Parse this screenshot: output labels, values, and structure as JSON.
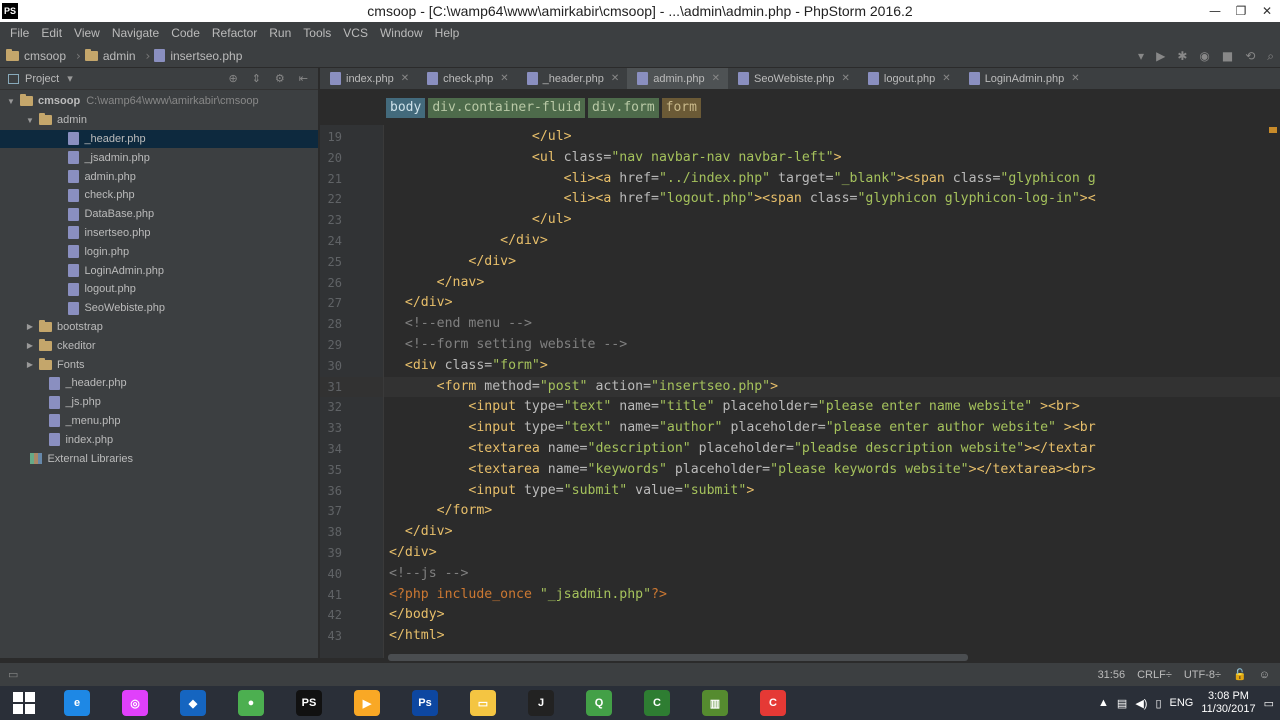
{
  "window": {
    "title": "cmsoop - [C:\\wamp64\\www\\amirkabir\\cmsoop] - ...\\admin\\admin.php - PhpStorm 2016.2",
    "app_icon": "PS"
  },
  "menu": [
    "File",
    "Edit",
    "View",
    "Navigate",
    "Code",
    "Refactor",
    "Run",
    "Tools",
    "VCS",
    "Window",
    "Help"
  ],
  "navbar": {
    "items": [
      "cmsoop",
      "admin",
      "insertseo.php"
    ]
  },
  "project": {
    "label": "Project",
    "root_name": "cmsoop",
    "root_path": "C:\\wamp64\\www\\amirkabir\\cmsoop",
    "admin_folder": "admin",
    "admin_files": [
      "_header.php",
      "_jsadmin.php",
      "admin.php",
      "check.php",
      "DataBase.php",
      "insertseo.php",
      "login.php",
      "LoginAdmin.php",
      "logout.php",
      "SeoWebiste.php"
    ],
    "folders": [
      "bootstrap",
      "ckeditor",
      "Fonts"
    ],
    "root_files": [
      "_header.php",
      "_js.php",
      "_menu.php",
      "index.php"
    ],
    "ext_libs": "External Libraries"
  },
  "tabs": [
    "index.php",
    "check.php",
    "_header.php",
    "admin.php",
    "SeoWebiste.php",
    "logout.php",
    "LoginAdmin.php"
  ],
  "breadcrumbs": [
    "body",
    "div.container-fluid",
    "div.form",
    "form"
  ],
  "code_lines": [
    {
      "n": "19",
      "segs": [
        [
          "t",
          "                  </ul>"
        ]
      ]
    },
    {
      "n": "20",
      "segs": [
        [
          "t",
          "                  <ul "
        ],
        [
          "a",
          "class="
        ],
        [
          "s",
          "\"nav navbar-nav navbar-left\""
        ],
        [
          "t",
          ">"
        ]
      ]
    },
    {
      "n": "21",
      "segs": [
        [
          "t",
          "                      <li><a "
        ],
        [
          "a",
          "href="
        ],
        [
          "s",
          "\"../index.php\""
        ],
        [
          "a",
          " target="
        ],
        [
          "s",
          "\"_blank\""
        ],
        [
          "t",
          "><span "
        ],
        [
          "a",
          "class="
        ],
        [
          "s",
          "\"glyphicon g"
        ]
      ]
    },
    {
      "n": "22",
      "segs": [
        [
          "t",
          "                      <li><a "
        ],
        [
          "a",
          "href="
        ],
        [
          "s",
          "\"logout.php\""
        ],
        [
          "t",
          "><span "
        ],
        [
          "a",
          "class="
        ],
        [
          "s",
          "\"glyphicon glyphicon-log-in\""
        ],
        [
          "t",
          "><"
        ]
      ]
    },
    {
      "n": "23",
      "segs": [
        [
          "t",
          "                  </ul>"
        ]
      ]
    },
    {
      "n": "24",
      "segs": [
        [
          "t",
          "              </div>"
        ]
      ]
    },
    {
      "n": "25",
      "segs": [
        [
          "t",
          "          </div>"
        ]
      ]
    },
    {
      "n": "26",
      "segs": [
        [
          "t",
          "      </nav>"
        ]
      ]
    },
    {
      "n": "27",
      "segs": [
        [
          "t",
          "  </div>"
        ]
      ]
    },
    {
      "n": "28",
      "segs": [
        [
          "c",
          "  <!--end menu -->"
        ]
      ]
    },
    {
      "n": "29",
      "segs": [
        [
          "c",
          "  <!--form setting website -->"
        ]
      ]
    },
    {
      "n": "30",
      "segs": [
        [
          "t",
          "  <div "
        ],
        [
          "a",
          "class="
        ],
        [
          "s",
          "\"form\""
        ],
        [
          "t",
          ">"
        ]
      ]
    },
    {
      "n": "31",
      "segs": [
        [
          "t",
          "      <form "
        ],
        [
          "a",
          "method="
        ],
        [
          "s",
          "\"post\""
        ],
        [
          "a",
          " action="
        ],
        [
          "s",
          "\"insertseo.php\""
        ],
        [
          "t",
          ">"
        ]
      ],
      "current": true
    },
    {
      "n": "32",
      "segs": [
        [
          "t",
          "          <input "
        ],
        [
          "a",
          "type="
        ],
        [
          "s",
          "\"text\""
        ],
        [
          "a",
          " name="
        ],
        [
          "s",
          "\"title\""
        ],
        [
          "a",
          " placeholder="
        ],
        [
          "s",
          "\"please enter name website\""
        ],
        [
          "t",
          " ><br>"
        ]
      ]
    },
    {
      "n": "33",
      "segs": [
        [
          "t",
          "          <input "
        ],
        [
          "a",
          "type="
        ],
        [
          "s",
          "\"text\""
        ],
        [
          "a",
          " name="
        ],
        [
          "s",
          "\"author\""
        ],
        [
          "a",
          " placeholder="
        ],
        [
          "s",
          "\"please enter author website\""
        ],
        [
          "t",
          " ><br"
        ]
      ]
    },
    {
      "n": "34",
      "segs": [
        [
          "t",
          "          <textarea "
        ],
        [
          "a",
          "name="
        ],
        [
          "s",
          "\"description\""
        ],
        [
          "a",
          " placeholder="
        ],
        [
          "s",
          "\"pleadse description website\""
        ],
        [
          "t",
          "></textar"
        ]
      ]
    },
    {
      "n": "35",
      "segs": [
        [
          "t",
          "          <textarea "
        ],
        [
          "a",
          "name="
        ],
        [
          "s",
          "\"keywords\""
        ],
        [
          "a",
          " placeholder="
        ],
        [
          "s",
          "\"please keywords website\""
        ],
        [
          "t",
          "></textarea><br>"
        ]
      ]
    },
    {
      "n": "36",
      "segs": [
        [
          "t",
          "          <input "
        ],
        [
          "a",
          "type="
        ],
        [
          "s",
          "\"submit\""
        ],
        [
          "a",
          " value="
        ],
        [
          "s",
          "\"submit\""
        ],
        [
          "t",
          ">"
        ]
      ]
    },
    {
      "n": "37",
      "segs": [
        [
          "t",
          "      </form>"
        ]
      ]
    },
    {
      "n": "38",
      "segs": [
        [
          "t",
          "  </div>"
        ]
      ]
    },
    {
      "n": "39",
      "segs": [
        [
          "t",
          "</div>"
        ]
      ]
    },
    {
      "n": "40",
      "segs": [
        [
          "c",
          "<!--js -->"
        ]
      ]
    },
    {
      "n": "41",
      "segs": [
        [
          "p",
          "<?php include_once "
        ],
        [
          "s",
          "\"_jsadmin.php\""
        ],
        [
          "p",
          "?>"
        ]
      ]
    },
    {
      "n": "42",
      "segs": [
        [
          "t",
          "</body>"
        ]
      ]
    },
    {
      "n": "43",
      "segs": [
        [
          "t",
          "</html>"
        ]
      ]
    }
  ],
  "status": {
    "position": "31:56",
    "line_sep": "CRLF÷",
    "encoding": "UTF-8÷"
  },
  "taskbar": {
    "apps": [
      {
        "name": "internet-explorer",
        "label": "e",
        "color": "#1e88e5"
      },
      {
        "name": "app-pink",
        "label": "◎",
        "color": "#e040fb"
      },
      {
        "name": "app-blue",
        "label": "◆",
        "color": "#1565c0"
      },
      {
        "name": "chrome",
        "label": "●",
        "color": "#4caf50"
      },
      {
        "name": "phpstorm",
        "label": "PS",
        "color": "#111111"
      },
      {
        "name": "player",
        "label": "▶",
        "color": "#f9a825"
      },
      {
        "name": "photoshop",
        "label": "Ps",
        "color": "#0d47a1"
      },
      {
        "name": "file-explorer",
        "label": "▭",
        "color": "#f4c542"
      },
      {
        "name": "jetbrains",
        "label": "J",
        "color": "#222222"
      },
      {
        "name": "app-green",
        "label": "Q",
        "color": "#43a047"
      },
      {
        "name": "camtasia-green",
        "label": "C",
        "color": "#2e7d32"
      },
      {
        "name": "app-chart",
        "label": "▥",
        "color": "#558b2f"
      },
      {
        "name": "camtasia-red",
        "label": "C",
        "color": "#e53935"
      }
    ],
    "language": "ENG",
    "time": "3:08 PM",
    "date": "11/30/2017"
  }
}
